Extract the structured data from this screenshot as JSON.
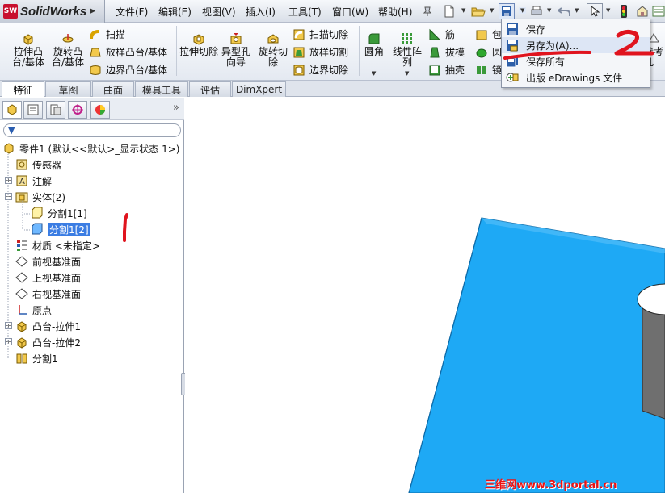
{
  "app": {
    "name": "SolidWorks",
    "logo_mark": "SW"
  },
  "menu": [
    "文件(F)",
    "编辑(E)",
    "视图(V)",
    "插入(I)",
    "工具(T)",
    "窗口(W)",
    "帮助(H)"
  ],
  "command_manager": {
    "extrude_boss": "拉伸凸台/基体",
    "revolve_boss": "旋转凸台/基体",
    "sweep": "扫描",
    "loft": "放样凸台/基体",
    "boundary_boss": "边界凸台/基体",
    "extrude_cut": "拉伸切除",
    "hole_wizard": "异型孔向导",
    "revolve_cut": "旋转切除",
    "sweep_cut": "扫描切除",
    "loft_cut": "放样切割",
    "boundary_cut": "边界切除",
    "fillet": "圆角",
    "linear_pattern": "线性阵列",
    "rib": "筋",
    "draft": "拔模",
    "shell": "抽壳",
    "partial_1": "包",
    "partial_2": "圆",
    "partial_3": "镜",
    "partial_right": "参考几"
  },
  "tabs": [
    "特征",
    "草图",
    "曲面",
    "模具工具",
    "评估",
    "DimXpert"
  ],
  "active_tab": 0,
  "tree": {
    "root": "零件1 (默认<<默认>_显示状态 1>)",
    "sensors": "传感器",
    "annotations": "注解",
    "solid_bodies": "实体(2)",
    "body_1": "分割1[1]",
    "body_2": "分割1[2]",
    "material": "材质 <未指定>",
    "front_plane": "前视基准面",
    "top_plane": "上视基准面",
    "right_plane": "右视基准面",
    "origin": "原点",
    "boss_extrude_1": "凸台-拉伸1",
    "boss_extrude_2": "凸台-拉伸2",
    "split_1": "分割1"
  },
  "save_menu": {
    "save": "保存",
    "save_as": "另存为(A)...",
    "save_all": "保存所有",
    "publish": "出版 eDrawings 文件"
  },
  "annotations": {
    "step_1": "1",
    "step_2": "2"
  },
  "watermark": "三维网www.3dportal.cn",
  "colors": {
    "model_face": "#1ea9f5",
    "selection": "#3b7de3",
    "annotation_red": "#e0141e",
    "brand_red": "#c8102e"
  }
}
